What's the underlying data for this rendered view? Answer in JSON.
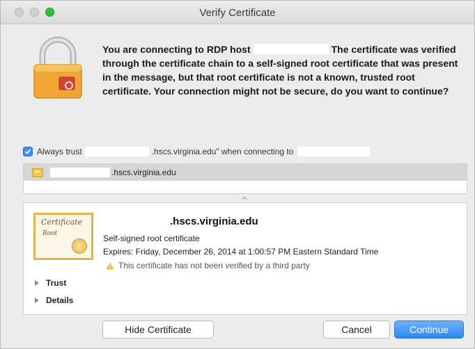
{
  "window": {
    "title": "Verify Certificate"
  },
  "message": {
    "part1": "You are connecting to RDP host",
    "part2": "The certificate was verified through the certificate chain to a self-signed root certificate that was present in the message, but that root certificate is not a known, trusted root certificate. Your connection might not be secure, do you want to continue?"
  },
  "trust_option": {
    "checked": true,
    "label_prefix": "Always trust",
    "label_middle": ".hscs.virginia.edu\" when connecting to"
  },
  "cert_list": {
    "items": [
      {
        "name": ".hscs.virginia.edu",
        "icon": "certificate-icon"
      }
    ]
  },
  "cert_detail": {
    "host": ".hscs.virginia.edu",
    "type": "Self-signed root certificate",
    "expires": "Expires: Friday, December 26, 2014 at 1:00:57 PM Eastern Standard Time",
    "warning": "This certificate has not been verified by a third party",
    "badge_title": "Certificate",
    "badge_sub": "Root",
    "sections": [
      {
        "label": "Trust"
      },
      {
        "label": "Details"
      }
    ]
  },
  "buttons": {
    "hide_certificate": "Hide Certificate",
    "cancel": "Cancel",
    "continue": "Continue"
  },
  "colors": {
    "accent": "#3a8ef5",
    "warning": "#f2b52c",
    "lock_body": "#f0a537"
  }
}
